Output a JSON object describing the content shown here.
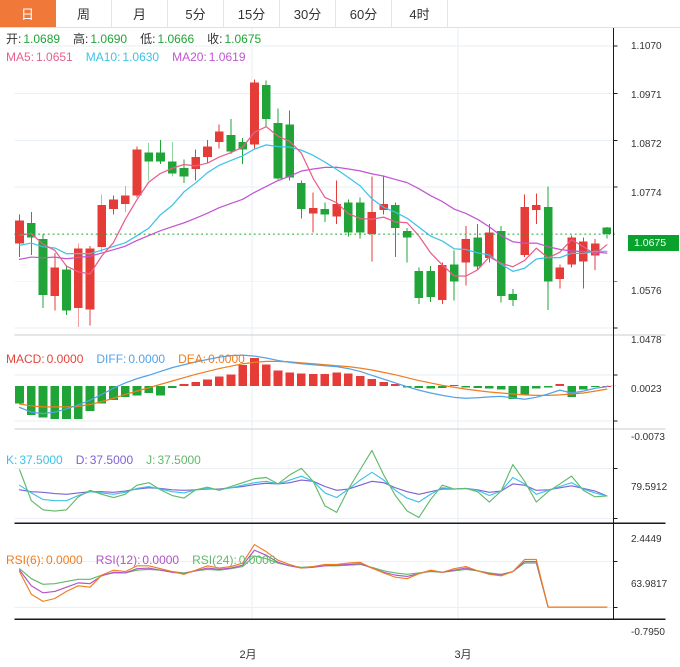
{
  "tabs": {
    "items": [
      {
        "id": "day",
        "label": "日",
        "active": true
      },
      {
        "id": "week",
        "label": "周",
        "active": false
      },
      {
        "id": "month",
        "label": "月",
        "active": false
      },
      {
        "id": "5min",
        "label": "5分",
        "active": false
      },
      {
        "id": "15min",
        "label": "15分",
        "active": false
      },
      {
        "id": "30min",
        "label": "30分",
        "active": false
      },
      {
        "id": "60min",
        "label": "60分",
        "active": false
      },
      {
        "id": "4hour",
        "label": "4时",
        "active": false
      }
    ]
  },
  "colors": {
    "up": "#e53c38",
    "down": "#21a437",
    "grid": "#e9eff5",
    "price_line": "#21a437",
    "badge_bg": "#0aa22f",
    "ma5": "#e85f8e",
    "ma10": "#3ec2e8",
    "ma20": "#c155d2",
    "diff": "#54a2e8",
    "dea": "#ef7d1f",
    "macd_label": "#e8433c",
    "k": "#3ec2e8",
    "d": "#7e62d4",
    "j": "#62b96a",
    "rsi6": "#ef7d1f",
    "rsi12": "#b055c6",
    "rsi24": "#62b96a",
    "ohlc_label": "#333333",
    "ohlc_value": "#21a437",
    "sep_light": "#cccccc",
    "sep_dark": "#1a1a1a",
    "macd_zero_dotted": "#8fc9f2",
    "tab_active_bg": "#f0793a"
  },
  "main_header": {
    "ohlc": [
      {
        "label": "开:",
        "value": "1.0689"
      },
      {
        "label": "高:",
        "value": "1.0690"
      },
      {
        "label": "低:",
        "value": "1.0666"
      },
      {
        "label": "收:",
        "value": "1.0675"
      }
    ],
    "ma": [
      {
        "label": "MA5:",
        "value": "1.0651",
        "color": "#e85f8e"
      },
      {
        "label": "MA10:",
        "value": "1.0630",
        "color": "#3ec2e8"
      },
      {
        "label": "MA20:",
        "value": "1.0619",
        "color": "#c155d2"
      }
    ]
  },
  "macd_header": {
    "items": [
      {
        "label": "MACD:",
        "value": "0.0000",
        "color": "#e8433c"
      },
      {
        "label": "DIFF:",
        "value": "0.0000",
        "color": "#54a2e8"
      },
      {
        "label": "DEA:",
        "value": "0.0000",
        "color": "#ef7d1f"
      }
    ]
  },
  "kdj_header": {
    "items": [
      {
        "label": "K:",
        "value": "37.5000",
        "color": "#3ec2e8"
      },
      {
        "label": "D:",
        "value": "37.5000",
        "color": "#7e62d4"
      },
      {
        "label": "J:",
        "value": "37.5000",
        "color": "#62b96a"
      }
    ]
  },
  "rsi_header": {
    "items": [
      {
        "label": "RSI(6):",
        "value": "0.0000",
        "color": "#ef7d1f"
      },
      {
        "label": "RSI(12):",
        "value": "0.0000",
        "color": "#b055c6"
      },
      {
        "label": "RSI(24):",
        "value": "0.0000",
        "color": "#62b96a"
      }
    ]
  },
  "chart_data": {
    "type": "candlestick",
    "x_axis_labels": [
      {
        "label": "2月",
        "x": 248
      },
      {
        "label": "3月",
        "x": 463
      }
    ],
    "main": {
      "y_ticks": [
        1.107,
        1.0971,
        1.0872,
        1.0774,
        1.0675,
        1.0576,
        1.0478
      ],
      "current_price": 1.0675,
      "current_price_label": "1.0675",
      "ma_periods": [
        5,
        10,
        20
      ],
      "ma_seed_closes": [
        1.057,
        1.0575,
        1.058,
        1.0585,
        1.059,
        1.0595,
        1.06,
        1.0605,
        1.061,
        1.0615,
        1.062,
        1.0625,
        1.063,
        1.0635,
        1.064,
        1.065,
        1.066,
        1.067,
        1.068
      ],
      "candles": {
        "columns": [
          "dir",
          "high",
          "body_top",
          "body_bottom",
          "low"
        ],
        "rows": [
          [
            "u",
            1.0716,
            1.0704,
            1.0655,
            1.0627
          ],
          [
            "d",
            1.0722,
            1.0698,
            1.0668,
            1.0631
          ],
          [
            "d",
            1.0675,
            1.0665,
            1.0547,
            1.052
          ],
          [
            "u",
            1.0635,
            1.0605,
            1.0545,
            1.0514
          ],
          [
            "d",
            1.061,
            1.0601,
            1.0514,
            1.0505
          ],
          [
            "u",
            1.0655,
            1.0645,
            1.052,
            1.048
          ],
          [
            "u",
            1.065,
            1.0645,
            1.0517,
            1.0483
          ],
          [
            "u",
            1.0758,
            1.0736,
            1.0648,
            1.0637
          ],
          [
            "u",
            1.0756,
            1.0748,
            1.0728,
            1.0716
          ],
          [
            "u",
            1.0776,
            1.0756,
            1.0738,
            1.0722
          ],
          [
            "u",
            1.0859,
            1.0853,
            1.0756,
            1.0752
          ],
          [
            "d",
            1.0867,
            1.0847,
            1.0828,
            1.0788
          ],
          [
            "d",
            1.0873,
            1.0847,
            1.0828,
            1.0822
          ],
          [
            "d",
            1.0869,
            1.0828,
            1.0802,
            1.0796
          ],
          [
            "d",
            1.0832,
            1.0814,
            1.0796,
            1.0782
          ],
          [
            "u",
            1.0853,
            1.0837,
            1.0812,
            1.0788
          ],
          [
            "u",
            1.0873,
            1.0859,
            1.0837,
            1.0826
          ],
          [
            "u",
            1.0905,
            1.0891,
            1.0869,
            1.0855
          ],
          [
            "d",
            1.0917,
            1.0883,
            1.0849,
            1.0843
          ],
          [
            "d",
            1.0877,
            1.0869,
            1.0853,
            1.0822
          ],
          [
            "u",
            1.1,
            1.0994,
            1.0863,
            1.0855
          ],
          [
            "d",
            1.0998,
            1.0988,
            1.0917,
            1.09
          ],
          [
            "d",
            1.0939,
            1.0909,
            1.0792,
            1.079
          ],
          [
            "d",
            1.0935,
            1.0905,
            1.0794,
            1.0788
          ],
          [
            "d",
            1.0788,
            1.0782,
            1.0728,
            1.0708
          ],
          [
            "u",
            1.0762,
            1.073,
            1.0718,
            1.0678
          ],
          [
            "d",
            1.0742,
            1.0728,
            1.0716,
            1.07
          ],
          [
            "u",
            1.0788,
            1.0738,
            1.0712,
            1.0696
          ],
          [
            "d",
            1.0748,
            1.0742,
            1.0678,
            1.067
          ],
          [
            "d",
            1.0752,
            1.0742,
            1.0678,
            1.0666
          ],
          [
            "u",
            1.0796,
            1.0722,
            1.0675,
            1.0617
          ],
          [
            "u",
            1.0798,
            1.0738,
            1.0726,
            1.0716
          ],
          [
            "d",
            1.0742,
            1.0736,
            1.0688,
            1.0627
          ],
          [
            "d",
            1.0688,
            1.0682,
            1.0668,
            1.0615
          ],
          [
            "d",
            1.0605,
            1.0597,
            1.0541,
            1.0528
          ],
          [
            "d",
            1.0608,
            1.0597,
            1.0543,
            1.0532
          ],
          [
            "u",
            1.0615,
            1.061,
            1.0537,
            1.0528
          ],
          [
            "d",
            1.0641,
            1.0611,
            1.0575,
            1.0535
          ],
          [
            "u",
            1.0692,
            1.0665,
            1.0615,
            1.0567
          ],
          [
            "d",
            1.0696,
            1.0668,
            1.0607,
            1.0601
          ],
          [
            "u",
            1.0696,
            1.0678,
            1.0625,
            1.0615
          ],
          [
            "d",
            1.0692,
            1.0682,
            1.0545,
            1.0531
          ],
          [
            "d",
            1.056,
            1.0549,
            1.0537,
            1.0524
          ],
          [
            "u",
            1.0758,
            1.0732,
            1.0631,
            1.0627
          ],
          [
            "u",
            1.076,
            1.0736,
            1.0726,
            1.0696
          ],
          [
            "d",
            1.0775,
            1.0732,
            1.0575,
            1.0516
          ],
          [
            "u",
            1.0611,
            1.0605,
            1.0581,
            1.0561
          ],
          [
            "u",
            1.0672,
            1.0668,
            1.0611,
            1.0605
          ],
          [
            "u",
            1.0668,
            1.066,
            1.0617,
            1.0561
          ],
          [
            "u",
            1.0665,
            1.0655,
            1.063,
            1.06
          ],
          [
            "d",
            1.069,
            1.0689,
            1.0675,
            1.0666
          ]
        ]
      }
    },
    "macd": {
      "y_ticks": [
        0.0023,
        -0.0073
      ],
      "histogram": [
        -0.0037,
        -0.0061,
        -0.0066,
        -0.0069,
        -0.0069,
        -0.0069,
        -0.0053,
        -0.0037,
        -0.003,
        -0.0023,
        -0.002,
        -0.0015,
        -0.002,
        -0.0005,
        0.0004,
        0.0008,
        0.0013,
        0.0019,
        0.0024,
        0.0043,
        0.0058,
        0.0044,
        0.0032,
        0.0028,
        0.0026,
        0.0025,
        0.0025,
        0.0028,
        0.0026,
        0.002,
        0.0014,
        0.0008,
        0.0004,
        -0.0003,
        -0.0005,
        -0.0006,
        -0.0005,
        0.0002,
        -0.0004,
        -0.0005,
        -0.0006,
        -0.0008,
        -0.0027,
        -0.0018,
        -0.0006,
        -0.0003,
        0.0004,
        -0.0023,
        -0.0008,
        -0.0002,
        0.0
      ],
      "diff": [
        -0.0045,
        -0.0055,
        -0.0058,
        -0.0055,
        -0.0048,
        -0.004,
        -0.003,
        -0.0018,
        -0.0005,
        0.0006,
        0.0015,
        0.0022,
        0.003,
        0.0038,
        0.0044,
        0.005,
        0.0055,
        0.006,
        0.0063,
        0.0064,
        0.0062,
        0.0058,
        0.0053,
        0.0049,
        0.0046,
        0.0044,
        0.0042,
        0.004,
        0.0036,
        0.003,
        0.0022,
        0.0014,
        0.0006,
        -0.0002,
        -0.0009,
        -0.0015,
        -0.002,
        -0.0024,
        -0.0026,
        -0.0025,
        -0.0023,
        -0.0022,
        -0.0025,
        -0.0028,
        -0.0024,
        -0.0017,
        -0.0009,
        -0.0015,
        -0.0011,
        -0.0005,
        -0.0002
      ],
      "dea": [
        -0.0038,
        -0.0042,
        -0.0044,
        -0.0044,
        -0.0044,
        -0.0043,
        -0.0039,
        -0.0033,
        -0.0026,
        -0.0018,
        -0.0011,
        -0.0004,
        0.0003,
        0.001,
        0.0017,
        0.0024,
        0.003,
        0.0036,
        0.0041,
        0.0046,
        0.0049,
        0.0051,
        0.0051,
        0.005,
        0.0048,
        0.0046,
        0.0044,
        0.0042,
        0.004,
        0.0037,
        0.0033,
        0.0028,
        0.0023,
        0.0017,
        0.0011,
        0.0006,
        0.0001,
        -0.0003,
        -0.0007,
        -0.001,
        -0.0013,
        -0.0015,
        -0.0017,
        -0.0019,
        -0.002,
        -0.002,
        -0.0019,
        -0.0017,
        -0.0015,
        -0.0011,
        -0.0007
      ]
    },
    "kdj": {
      "y_ticks": [
        79.5912,
        2.4449
      ],
      "k": [
        54,
        42,
        32,
        30,
        30,
        38,
        44,
        42,
        40,
        43,
        49,
        52,
        48,
        44,
        42,
        47,
        49,
        47,
        50,
        54,
        58,
        60,
        56,
        62,
        68,
        60,
        42,
        35,
        48,
        62,
        74,
        62,
        46,
        34,
        28,
        40,
        50,
        48,
        49,
        46,
        38,
        45,
        66,
        56,
        40,
        46,
        52,
        58,
        48,
        42,
        37.5
      ],
      "d": [
        47,
        44,
        43,
        41,
        40,
        42,
        44,
        44,
        43,
        45,
        48,
        50,
        49,
        47,
        46,
        47,
        48,
        48,
        50,
        52,
        55,
        57,
        56,
        58,
        62,
        60,
        52,
        46,
        48,
        54,
        60,
        58,
        50,
        44,
        40,
        44,
        48,
        48,
        49,
        47,
        43,
        45,
        56,
        54,
        46,
        47,
        50,
        53,
        49,
        45,
        37.5
      ],
      "j": [
        78,
        30,
        16,
        14,
        16,
        36,
        46,
        40,
        35,
        40,
        54,
        58,
        47,
        38,
        34,
        47,
        51,
        46,
        52,
        58,
        64,
        66,
        56,
        70,
        80,
        60,
        22,
        12,
        48,
        78,
        108,
        70,
        38,
        14,
        4,
        32,
        54,
        48,
        49,
        44,
        28,
        45,
        86,
        60,
        28,
        44,
        56,
        68,
        46,
        36,
        37.5
      ]
    },
    "rsi": {
      "y_ticks": [
        63.9817,
        -0.795
      ],
      "rsi6": [
        50,
        18,
        8,
        12,
        22,
        30,
        28,
        45,
        52,
        50,
        58,
        58,
        54,
        50,
        46,
        52,
        58,
        55,
        57,
        62,
        88,
        78,
        66,
        60,
        55,
        57,
        60,
        60,
        62,
        63,
        55,
        48,
        42,
        40,
        47,
        52,
        49,
        54,
        57,
        51,
        46,
        44,
        50,
        67,
        67,
        0,
        0,
        0,
        0,
        0,
        0
      ],
      "rsi12": [
        52,
        30,
        20,
        22,
        28,
        34,
        33,
        44,
        49,
        48,
        54,
        55,
        52,
        49,
        47,
        51,
        55,
        53,
        55,
        59,
        80,
        73,
        63,
        58,
        55,
        56,
        58,
        59,
        60,
        61,
        55,
        49,
        45,
        43,
        47,
        51,
        49,
        52,
        55,
        51,
        47,
        45,
        50,
        64,
        64,
        0,
        0,
        0,
        0,
        0,
        0
      ],
      "rsi24": [
        54,
        40,
        32,
        33,
        36,
        39,
        39,
        45,
        48,
        48,
        52,
        53,
        52,
        50,
        48,
        51,
        53,
        52,
        54,
        57,
        72,
        68,
        62,
        58,
        56,
        57,
        58,
        58,
        59,
        60,
        56,
        51,
        48,
        46,
        48,
        50,
        49,
        51,
        53,
        51,
        48,
        46,
        50,
        62,
        62,
        0,
        0,
        0,
        0,
        0,
        0
      ]
    }
  }
}
